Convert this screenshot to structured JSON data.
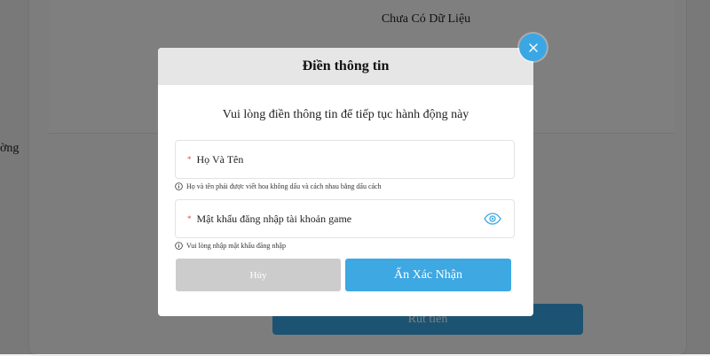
{
  "background": {
    "empty_text": "Chưa Có Dữ Liệu",
    "left_text": "ờng",
    "withdraw_button": "Rút tiền"
  },
  "modal": {
    "title": "Điền thông tin",
    "subtitle": "Vui lòng điền thông tin để tiếp tục hành động này",
    "name_field": {
      "placeholder": "Họ Và Tên",
      "value": ""
    },
    "name_hint": "Họ và tên phải được viết hoa không dấu và cách nhau bằng dấu cách",
    "password_field": {
      "placeholder": "Mật khẩu đăng nhập tài khoản game",
      "value": ""
    },
    "password_hint": "Vui lòng nhập mật khẩu đăng nhập",
    "cancel_button": "Hủy",
    "confirm_button": "Ấn Xác Nhận"
  },
  "colors": {
    "accent": "#3ea8e3",
    "required": "#e34a4a",
    "cancel_bg": "#cccccc",
    "header_bg": "#e6e6e6"
  },
  "icons": {
    "close": "close-icon",
    "info": "info-icon",
    "eye": "eye-icon"
  }
}
